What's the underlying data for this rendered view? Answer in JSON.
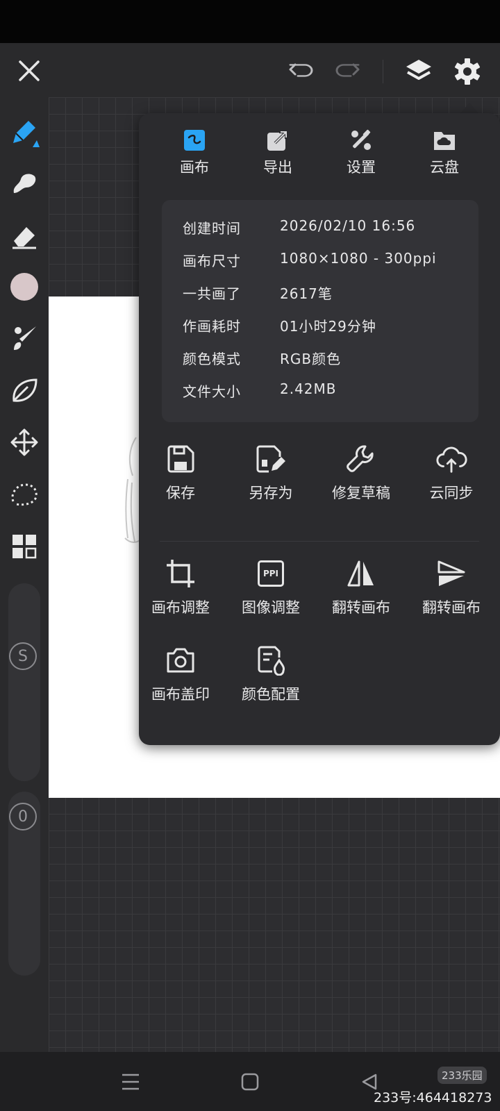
{
  "colors": {
    "accent": "#2aa4f4",
    "panel": "#2b2b2e",
    "text": "#e9e9ea",
    "current_color_swatch": "#d8c7c9"
  },
  "top_bar": {
    "close_icon": "close-icon",
    "undo_icon": "undo-icon",
    "redo_icon": "redo-icon",
    "layers_icon": "layers-icon",
    "settings_icon": "gear-icon"
  },
  "toolbar": {
    "tools": [
      "pen-icon",
      "smudge-icon",
      "eraser-icon",
      "color-swatch",
      "brush-icon",
      "leaf-icon",
      "move-icon",
      "lasso-icon",
      "grid-icon"
    ],
    "size_slider_label": "S",
    "opacity_slider_label": "0"
  },
  "panel": {
    "tabs": [
      {
        "label": "画布",
        "icon": "canvas-icon",
        "active": true
      },
      {
        "label": "导出",
        "icon": "export-icon",
        "active": false
      },
      {
        "label": "设置",
        "icon": "settings-tools-icon",
        "active": false
      },
      {
        "label": "云盘",
        "icon": "cloud-disk-icon",
        "active": false
      }
    ],
    "info": [
      {
        "key": "创建时间",
        "value": "2026/02/10 16:56"
      },
      {
        "key": "画布尺寸",
        "value": "1080×1080 - 300ppi"
      },
      {
        "key": "一共画了",
        "value": "2617笔"
      },
      {
        "key": "作画耗时",
        "value": "01小时29分钟"
      },
      {
        "key": "颜色模式",
        "value": "RGB颜色"
      },
      {
        "key": "文件大小",
        "value": "2.42MB"
      }
    ],
    "actions_row1": [
      {
        "label": "保存",
        "icon": "save-icon"
      },
      {
        "label": "另存为",
        "icon": "save-as-icon"
      },
      {
        "label": "修复草稿",
        "icon": "wrench-icon"
      },
      {
        "label": "云同步",
        "icon": "cloud-sync-icon"
      }
    ],
    "actions_row2": [
      {
        "label": "画布调整",
        "icon": "crop-icon"
      },
      {
        "label": "图像调整",
        "icon": "ppi-icon",
        "icon_text": "PPI"
      },
      {
        "label": "翻转画布",
        "icon": "flip-horizontal-icon"
      },
      {
        "label": "翻转画布",
        "icon": "flip-vertical-icon"
      }
    ],
    "actions_row3": [
      {
        "label": "画布盖印",
        "icon": "camera-icon"
      },
      {
        "label": "颜色配置",
        "icon": "color-config-icon"
      }
    ]
  },
  "watermark": {
    "badge": "233乐园",
    "text": "233号:464418273"
  }
}
